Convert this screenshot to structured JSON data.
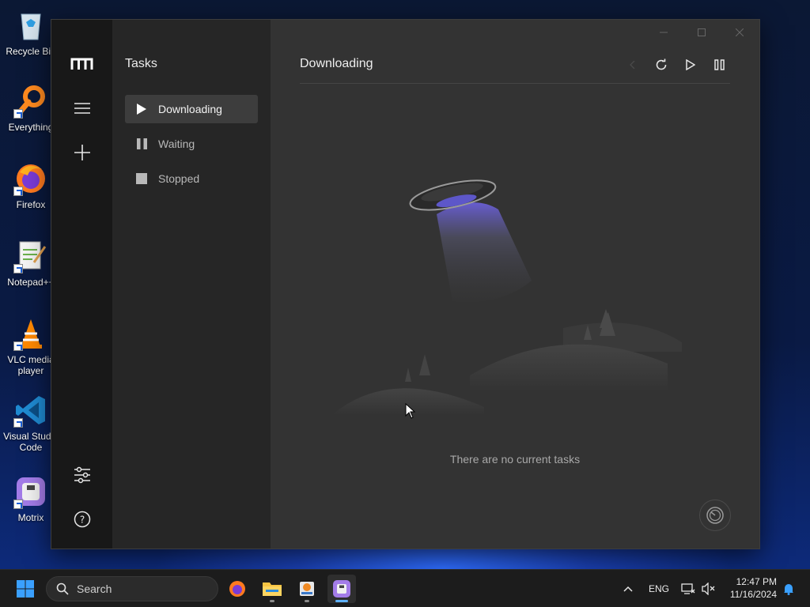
{
  "desktop": {
    "icons": [
      {
        "label": "Recycle Bin",
        "icon": "recycle-bin-icon"
      },
      {
        "label": "Everything",
        "icon": "everything-icon"
      },
      {
        "label": "Firefox",
        "icon": "firefox-icon"
      },
      {
        "label": "Notepad++",
        "icon": "notepad-plus-plus-icon"
      },
      {
        "label": "VLC media player",
        "icon": "vlc-icon"
      },
      {
        "label": "Visual Studio Code",
        "icon": "vscode-icon"
      },
      {
        "label": "Motrix",
        "icon": "motrix-icon"
      }
    ]
  },
  "app": {
    "rail": {
      "logo": "motrix-logo-icon",
      "menu": "menu-icon",
      "add": "plus-icon",
      "preferences": "sliders-icon",
      "help": "help-icon"
    },
    "subnav": {
      "title": "Tasks",
      "items": [
        {
          "label": "Downloading",
          "icon": "play-icon",
          "active": true
        },
        {
          "label": "Waiting",
          "icon": "pause-icon",
          "active": false
        },
        {
          "label": "Stopped",
          "icon": "stop-icon",
          "active": false
        }
      ]
    },
    "main": {
      "title": "Downloading",
      "empty_message": "There are no current tasks",
      "toolbar": [
        "chevron-left-icon",
        "refresh-icon",
        "play-icon",
        "pause-icon"
      ]
    }
  },
  "taskbar": {
    "search_placeholder": "Search",
    "apps": [
      "start-icon",
      "firefox-icon",
      "file-explorer-icon",
      "installer-icon",
      "motrix-icon"
    ],
    "tray": {
      "language": "ENG",
      "time": "12:47 PM",
      "date": "11/16/2024"
    }
  },
  "colors": {
    "accent": "#5fb2ff",
    "app_bg": "#333333",
    "rail_bg": "#181818",
    "subnav_bg": "#262626",
    "active_item_bg": "#3d3d3d"
  }
}
